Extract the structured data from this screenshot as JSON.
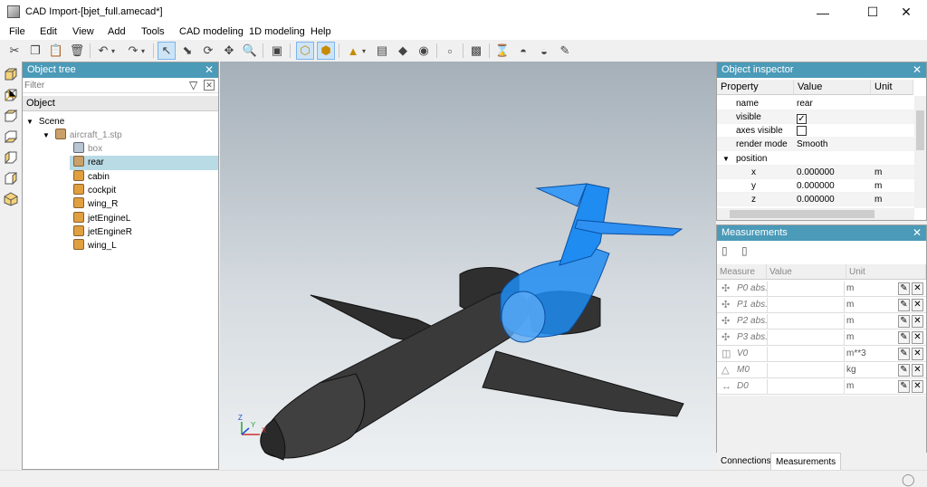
{
  "window": {
    "title": "CAD Import-[bjet_full.amecad*]"
  },
  "menu": [
    "File",
    "Edit",
    "View",
    "Add",
    "Tools",
    "CAD modeling",
    "1D modeling",
    "Help"
  ],
  "object_tree": {
    "title": "Object tree",
    "filter_placeholder": "Filter",
    "column": "Object",
    "scene": "Scene",
    "file": "aircraft_1.stp",
    "parts": [
      "box",
      "rear",
      "cabin",
      "cockpit",
      "wing_R",
      "jetEngineL",
      "jetEngineR",
      "wing_L"
    ],
    "selected": "rear"
  },
  "inspector": {
    "title": "Object inspector",
    "headers": {
      "property": "Property",
      "value": "Value",
      "unit": "Unit"
    },
    "rows": {
      "name": {
        "label": "name",
        "value": "rear"
      },
      "visible": {
        "label": "visible",
        "checked": true
      },
      "axes_visible": {
        "label": "axes visible",
        "checked": false
      },
      "render_mode": {
        "label": "render mode",
        "value": "Smooth"
      },
      "position": {
        "label": "position"
      },
      "x": {
        "label": "x",
        "value": "0.000000",
        "unit": "m"
      },
      "y": {
        "label": "y",
        "value": "0.000000",
        "unit": "m"
      },
      "z": {
        "label": "z",
        "value": "0.000000",
        "unit": "m"
      }
    }
  },
  "measurements": {
    "title": "Measurements",
    "headers": {
      "measure": "Measure",
      "value": "Value",
      "unit": "Unit"
    },
    "rows": [
      {
        "name": "P0 abs.",
        "unit": "m"
      },
      {
        "name": "P1 abs.",
        "unit": "m"
      },
      {
        "name": "P2 abs.",
        "unit": "m"
      },
      {
        "name": "P3 abs.",
        "unit": "m"
      },
      {
        "name": "V0",
        "unit": "m**3"
      },
      {
        "name": "M0",
        "unit": "kg"
      },
      {
        "name": "D0",
        "unit": "m"
      }
    ]
  },
  "tabs": {
    "connections": "Connections",
    "measurements": "Measurements",
    "active": "Measurements"
  },
  "axes": {
    "x": "X",
    "y": "Y",
    "z": "Z"
  },
  "colors": {
    "panel_header": "#4a9ab8",
    "selection": "#b9dbe6",
    "airplane_body": "#3a3a3a",
    "selected_part": "#1f8cf2"
  }
}
